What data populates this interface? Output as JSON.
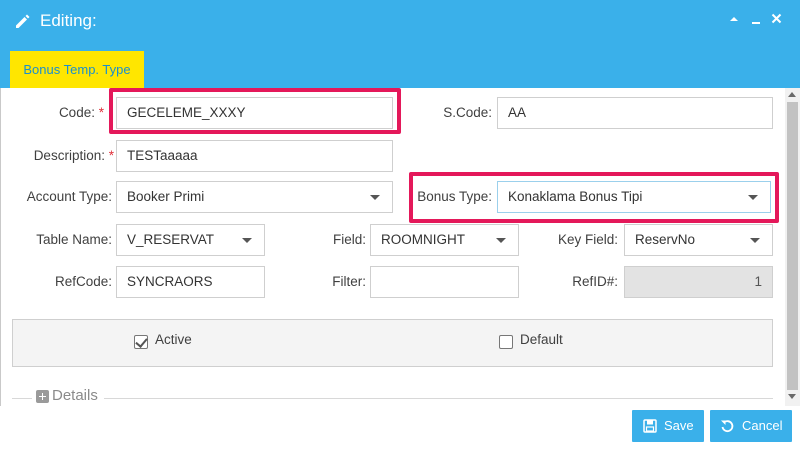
{
  "window": {
    "title": "Editing:"
  },
  "tabs": [
    {
      "label": "Bonus Temp. Type"
    }
  ],
  "form": {
    "code": {
      "label": "Code:",
      "required_mark": "*",
      "value": "GECELEME_XXXY"
    },
    "scode": {
      "label": "S.Code:",
      "value": "AA"
    },
    "description": {
      "label": "Description:",
      "required_mark": "*",
      "value": "TESTaaaaa"
    },
    "account_type": {
      "label": "Account Type:",
      "value": "Booker Primi"
    },
    "bonus_type": {
      "label": "Bonus Type:",
      "value": "Konaklama Bonus Tipi"
    },
    "table_name": {
      "label": "Table Name:",
      "value": "V_RESERVAT"
    },
    "field": {
      "label": "Field:",
      "value": "ROOMNIGHT"
    },
    "key_field": {
      "label": "Key Field:",
      "value": "ReservNo"
    },
    "refcode": {
      "label": "RefCode:",
      "value": "SYNCRAORS"
    },
    "filter": {
      "label": "Filter:",
      "value": ""
    },
    "refid": {
      "label": "RefID#:",
      "value": "1"
    }
  },
  "checkboxes": {
    "active": {
      "label": "Active",
      "checked": true
    },
    "default": {
      "label": "Default",
      "checked": false
    }
  },
  "details": {
    "label": "Details"
  },
  "footer": {
    "save_label": "Save",
    "cancel_label": "Cancel"
  },
  "colors": {
    "accent": "#3ab0ea",
    "tab": "#ffe600",
    "highlight": "#e4185a",
    "required": "#e0303a"
  }
}
